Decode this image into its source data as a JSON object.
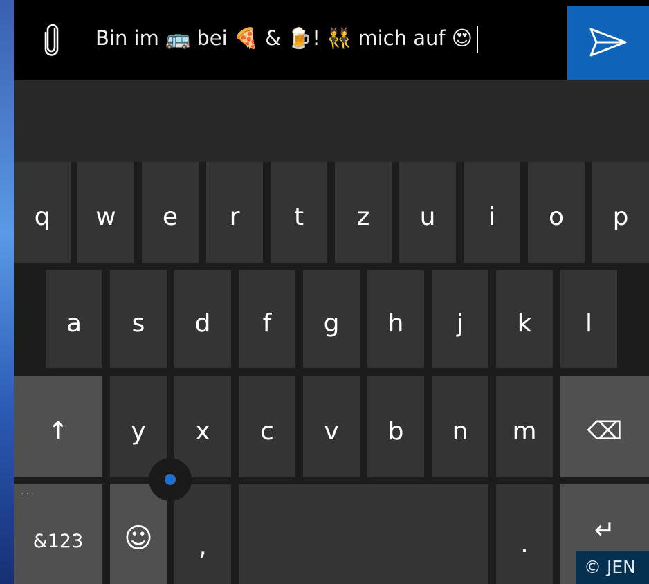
{
  "message": {
    "text": "Bin im 🚌 bei 🍕 & 🍺! 👯 mich auf 😍",
    "attach_icon": "paperclip-icon",
    "send_icon": "send-icon",
    "send_color": "#0f63b8"
  },
  "keyboard": {
    "row1": [
      "q",
      "w",
      "e",
      "r",
      "t",
      "z",
      "u",
      "i",
      "o",
      "p"
    ],
    "row2": [
      "a",
      "s",
      "d",
      "f",
      "g",
      "h",
      "j",
      "k",
      "l"
    ],
    "row3": [
      "y",
      "x",
      "c",
      "v",
      "b",
      "n",
      "m"
    ],
    "shift": "↑",
    "backspace": "⌫",
    "symbols": "&123",
    "emoji": "☺",
    "comma": ",",
    "period": ".",
    "enter": "↵"
  },
  "watermark": "© JEN"
}
